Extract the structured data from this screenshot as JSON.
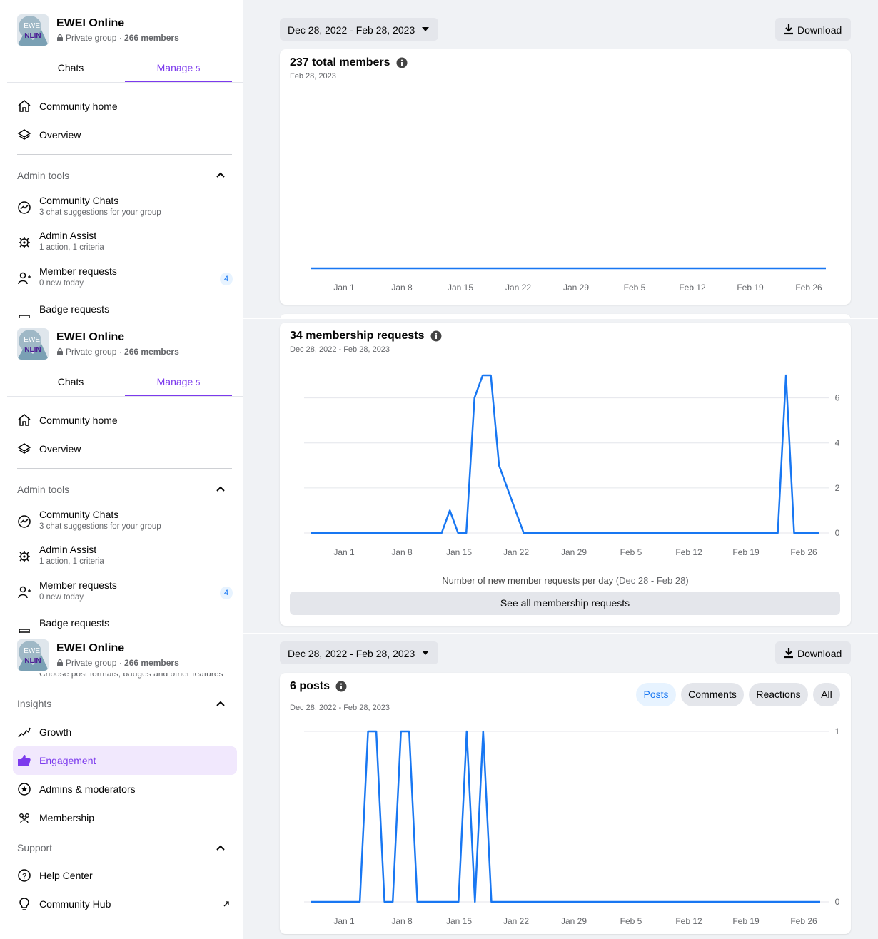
{
  "group": {
    "name": "EWEI Online",
    "privacy": "Private group · ",
    "members": "266 members",
    "avatar_text_top": "EWEI",
    "avatar_text_bottom": "NLIN"
  },
  "tabs": {
    "chats": "Chats",
    "manage": "Manage",
    "manage_count": "5"
  },
  "nav": {
    "community_home": "Community home",
    "overview": "Overview"
  },
  "admin_tools": {
    "title": "Admin tools",
    "community_chats": {
      "label": "Community Chats",
      "sub": "3 chat suggestions for your group"
    },
    "admin_assist": {
      "label": "Admin Assist",
      "sub": "1 action, 1 criteria"
    },
    "member_requests": {
      "label": "Member requests",
      "sub": "0 new today",
      "badge": "4"
    },
    "badge_requests": {
      "label": "Badge requests"
    }
  },
  "clipped_text": "Choose post formats, badges and other features",
  "insights": {
    "title": "Insights",
    "growth": "Growth",
    "engagement": "Engagement",
    "admins": "Admins & moderators",
    "membership": "Membership"
  },
  "support": {
    "title": "Support",
    "help": "Help Center",
    "hub": "Community Hub"
  },
  "toolbar": {
    "date_range": "Dec 28, 2022 - Feb 28, 2023",
    "download": "Download"
  },
  "members_card": {
    "title": "237 total members",
    "date": "Feb 28, 2023"
  },
  "requests_card": {
    "title": "34 membership requests",
    "date": "Dec 28, 2022 - Feb 28, 2023",
    "caption_main": "Number of new member requests per day",
    "caption_range": " (Dec 28 - Feb 28)",
    "see_all": "See all membership requests"
  },
  "posts_card": {
    "title": "6 posts",
    "date": "Dec 28, 2022 - Feb 28, 2023",
    "filters": [
      "Posts",
      "Comments",
      "Reactions",
      "All"
    ],
    "active_filter": "Posts"
  },
  "colors": {
    "accent": "#7c3aed",
    "line": "#1877f2",
    "grid": "#e4e6eb"
  },
  "chart_data": [
    {
      "type": "line",
      "title": "237 total members",
      "subtitle": "Feb 28, 2023",
      "x_ticks": [
        "Jan 1",
        "Jan 8",
        "Jan 15",
        "Jan 22",
        "Jan 29",
        "Feb 5",
        "Feb 12",
        "Feb 19",
        "Feb 26"
      ],
      "x_range": [
        0,
        62
      ],
      "y_ticks": [],
      "series": [
        {
          "x": [
            0,
            62
          ],
          "y": [
            237,
            237
          ]
        }
      ]
    },
    {
      "type": "line",
      "title": "34 membership requests",
      "subtitle": "Dec 28, 2022 - Feb 28, 2023",
      "x_ticks": [
        "Jan 1",
        "Jan 8",
        "Jan 15",
        "Jan 22",
        "Jan 29",
        "Feb 5",
        "Feb 12",
        "Feb 19",
        "Feb 26"
      ],
      "x_range": [
        0,
        62
      ],
      "y_ticks": [
        0,
        2,
        4,
        6
      ],
      "ylim": [
        0,
        7
      ],
      "series": [
        {
          "x": [
            0,
            1,
            2,
            3,
            4,
            5,
            6,
            7,
            8,
            9,
            10,
            11,
            12,
            13,
            14,
            15,
            16,
            17,
            18,
            19,
            20,
            21,
            22,
            23,
            24,
            25,
            26,
            27,
            28,
            29,
            30,
            31,
            32,
            33,
            34,
            35,
            36,
            37,
            38,
            39,
            40,
            41,
            42,
            43,
            44,
            45,
            46,
            47,
            48,
            49,
            50,
            51,
            52,
            53,
            54,
            55,
            56,
            57,
            58,
            59,
            60,
            61,
            62
          ],
          "y": [
            0,
            0,
            0,
            0,
            0,
            0,
            0,
            0,
            0,
            0,
            0,
            0,
            0,
            0,
            0,
            0,
            0,
            1,
            0,
            0,
            6,
            7,
            7,
            3,
            2,
            1,
            0,
            0,
            0,
            0,
            0,
            0,
            0,
            0,
            0,
            0,
            0,
            0,
            0,
            0,
            0,
            0,
            0,
            0,
            0,
            0,
            0,
            0,
            0,
            0,
            0,
            0,
            0,
            0,
            0,
            0,
            0,
            0,
            7,
            0,
            0,
            0,
            0
          ]
        }
      ]
    },
    {
      "type": "line",
      "title": "6 posts",
      "subtitle": "Dec 28, 2022 - Feb 28, 2023",
      "x_ticks": [
        "Jan 1",
        "Jan 8",
        "Jan 15",
        "Jan 22",
        "Jan 29",
        "Feb 5",
        "Feb 12",
        "Feb 19",
        "Feb 26"
      ],
      "x_range": [
        0,
        62
      ],
      "y_ticks": [
        0,
        1
      ],
      "ylim": [
        0,
        1
      ],
      "series": [
        {
          "x": [
            0,
            1,
            2,
            3,
            4,
            5,
            6,
            7,
            8,
            9,
            10,
            11,
            12,
            13,
            14,
            15,
            16,
            17,
            18,
            19,
            20,
            21,
            22,
            23,
            24,
            25,
            26,
            27,
            28,
            29,
            30,
            31,
            32,
            33,
            34,
            35,
            36,
            37,
            38,
            39,
            40,
            41,
            42,
            43,
            44,
            45,
            46,
            47,
            48,
            49,
            50,
            51,
            52,
            53,
            54,
            55,
            56,
            57,
            58,
            59,
            60,
            61,
            62
          ],
          "y": [
            0,
            0,
            0,
            0,
            0,
            0,
            0,
            1,
            1,
            0,
            0,
            1,
            1,
            0,
            0,
            0,
            0,
            0,
            0,
            1,
            0,
            1,
            0,
            0,
            0,
            0,
            0,
            0,
            0,
            0,
            0,
            0,
            0,
            0,
            0,
            0,
            0,
            0,
            0,
            0,
            0,
            0,
            0,
            0,
            0,
            0,
            0,
            0,
            0,
            0,
            0,
            0,
            0,
            0,
            0,
            0,
            0,
            0,
            0,
            0,
            0,
            0,
            0
          ]
        }
      ]
    }
  ]
}
